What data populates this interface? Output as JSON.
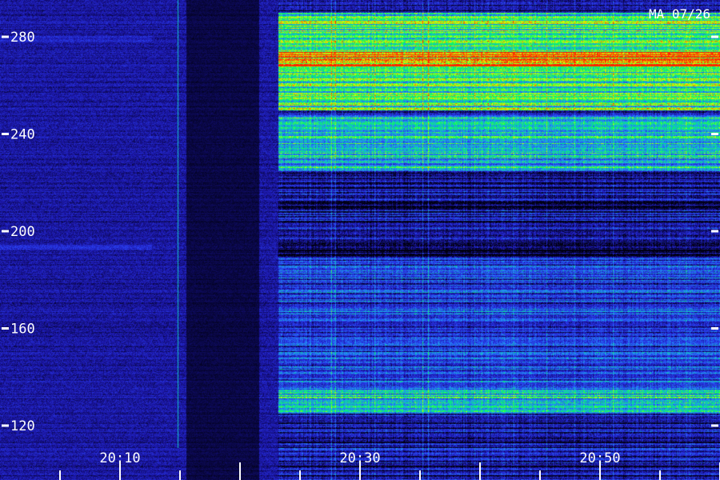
{
  "chart_data": {
    "type": "heatmap",
    "title": "MA 07/26",
    "xlabel": "",
    "ylabel": "",
    "x_ticks": [
      "20:10",
      "20:30",
      "20:50"
    ],
    "y_ticks": [
      120,
      160,
      200,
      240,
      280
    ],
    "ylim": [
      108,
      295
    ],
    "xlim": [
      "20:02",
      "21:00"
    ],
    "colormap": [
      "#000010",
      "#1a14a0",
      "#2a3cf0",
      "#1ea0f0",
      "#00ff60",
      "#e0ff00",
      "#ff2000"
    ],
    "bands": [
      {
        "y_from": 250,
        "y_to": 290,
        "x_from": "20:23",
        "x_to": "21:00",
        "intensity": "high"
      },
      {
        "y_from": 268,
        "y_to": 274,
        "x_from": "20:23",
        "x_to": "21:00",
        "intensity": "peak"
      },
      {
        "y_from": 225,
        "y_to": 248,
        "x_from": "20:23",
        "x_to": "21:00",
        "intensity": "medium"
      },
      {
        "y_from": 125,
        "y_to": 135,
        "x_from": "20:23",
        "x_to": "21:00",
        "intensity": "medium"
      },
      {
        "y_from": 135,
        "y_to": 190,
        "x_from": "20:23",
        "x_to": "21:00",
        "intensity": "low"
      }
    ],
    "grid": false,
    "legend": "none"
  }
}
